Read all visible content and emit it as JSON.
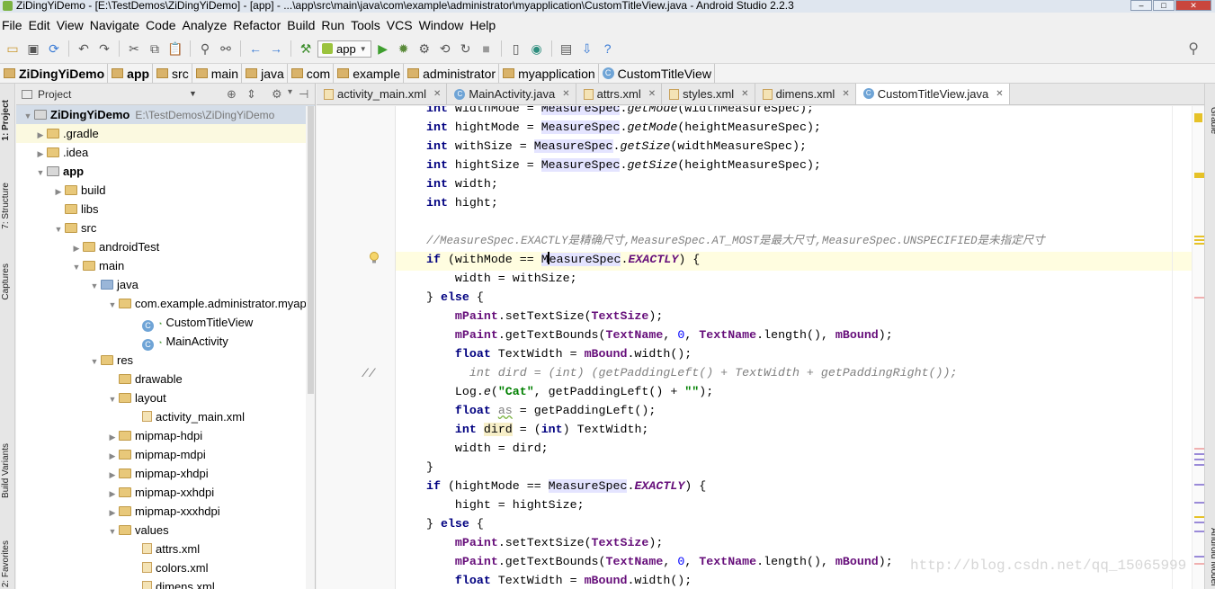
{
  "window": {
    "title": "ZiDingYiDemo - [E:\\TestDemos\\ZiDingYiDemo] - [app] - ...\\app\\src\\main\\java\\com\\example\\administrator\\myapplication\\CustomTitleView.java - Android Studio 2.2.3",
    "min": "–",
    "max": "□",
    "close": "✕"
  },
  "menu": [
    "File",
    "Edit",
    "View",
    "Navigate",
    "Code",
    "Analyze",
    "Refactor",
    "Build",
    "Run",
    "Tools",
    "VCS",
    "Window",
    "Help"
  ],
  "toolbar": {
    "run_config": "app"
  },
  "breadcrumb": [
    "ZiDingYiDemo",
    "app",
    "src",
    "main",
    "java",
    "com",
    "example",
    "administrator",
    "myapplication",
    "CustomTitleView"
  ],
  "side_tabs": {
    "left": [
      "1: Project",
      "7: Structure",
      "Captures",
      "Build Variants",
      "2: Favorites"
    ],
    "right": [
      "Gradle",
      "Android Model"
    ]
  },
  "project_panel": {
    "view_mode": "Project",
    "tree": [
      {
        "label": "ZiDingYiDemo",
        "path": "E:\\TestDemos\\ZiDingYiDemo"
      },
      {
        "label": ".gradle"
      },
      {
        "label": ".idea"
      },
      {
        "label": "app"
      },
      {
        "label": "build"
      },
      {
        "label": "libs"
      },
      {
        "label": "src"
      },
      {
        "label": "androidTest"
      },
      {
        "label": "main"
      },
      {
        "label": "java"
      },
      {
        "label": "com.example.administrator.myap"
      },
      {
        "label": "CustomTitleView"
      },
      {
        "label": "MainActivity"
      },
      {
        "label": "res"
      },
      {
        "label": "drawable"
      },
      {
        "label": "layout"
      },
      {
        "label": "activity_main.xml"
      },
      {
        "label": "mipmap-hdpi"
      },
      {
        "label": "mipmap-mdpi"
      },
      {
        "label": "mipmap-xhdpi"
      },
      {
        "label": "mipmap-xxhdpi"
      },
      {
        "label": "mipmap-xxxhdpi"
      },
      {
        "label": "values"
      },
      {
        "label": "attrs.xml"
      },
      {
        "label": "colors.xml"
      },
      {
        "label": "dimens.xml"
      }
    ]
  },
  "editor_tabs": [
    {
      "label": "activity_main.xml",
      "active": false
    },
    {
      "label": "MainActivity.java",
      "active": false
    },
    {
      "label": "attrs.xml",
      "active": false
    },
    {
      "label": "styles.xml",
      "active": false
    },
    {
      "label": "dimens.xml",
      "active": false
    },
    {
      "label": "CustomTitleView.java",
      "active": true
    }
  ],
  "code": {
    "l1a": "int",
    "l1b": " widthMode = ",
    "l1c": "MeasureSpec",
    "l1d": ".",
    "l1e": "getMode",
    "l1f": "(widthMeasureSpec);",
    "l2a": "int",
    "l2b": " hightMode = ",
    "l2c": "MeasureSpec",
    "l2d": ".",
    "l2e": "getMode",
    "l2f": "(heightMeasureSpec);",
    "l3a": "int",
    "l3b": " withSize = ",
    "l3c": "MeasureSpec",
    "l3d": ".",
    "l3e": "getSize",
    "l3f": "(widthMeasureSpec);",
    "l4a": "int",
    "l4b": " hightSize = ",
    "l4c": "MeasureSpec",
    "l4d": ".",
    "l4e": "getSize",
    "l4f": "(heightMeasureSpec);",
    "l5a": "int",
    "l5b": " width;",
    "l6a": "int",
    "l6b": " hight;",
    "l8": "//MeasureSpec.EXACTLY是精确尺寸,MeasureSpec.AT_MOST是最大尺寸,MeasureSpec.UNSPECIFIED是未指定尺寸",
    "l9a": "if",
    "l9b": " (withMode == ",
    "l9c": "M",
    "l9d": "easureSpec",
    "l9e": ".",
    "l9f": "EXACTLY",
    "l9g": ") {",
    "l10": "    width = withSize;",
    "l11a": "} ",
    "l11b": "else",
    "l11c": " {",
    "l12a": "    ",
    "l12b": "mPaint",
    "l12c": ".setTextSize(",
    "l12d": "TextSize",
    "l12e": ");",
    "l13a": "    ",
    "l13b": "mPaint",
    "l13c": ".getTextBounds(",
    "l13d": "TextName",
    "l13e": ", ",
    "l13f": "0",
    "l13g": ", ",
    "l13h": "TextName",
    "l13i": ".length(), ",
    "l13j": "mBound",
    "l13k": ");",
    "l14a": "    ",
    "l14b": "float",
    "l14c": " TextWidth = ",
    "l14d": "mBound",
    "l14e": ".width();",
    "l15cm": "//",
    "l15": "      int dird = (int) (getPaddingLeft() + TextWidth + getPaddingRight());",
    "l16a": "    Log.",
    "l16b": "e",
    "l16c": "(",
    "l16d": "\"Cat\"",
    "l16e": ", getPaddingLeft() + ",
    "l16f": "\"\"",
    "l16g": ");",
    "l17a": "    ",
    "l17b": "float",
    "l17c": " ",
    "l17d": "as",
    "l17e": " = getPaddingLeft();",
    "l18a": "    ",
    "l18b": "int",
    "l18c": " ",
    "l18d": "dird",
    "l18e": " = (",
    "l18f": "int",
    "l18g": ") TextWidth;",
    "l19": "    width = dird;",
    "l20": "}",
    "l21a": "if",
    "l21b": " (hightMode == ",
    "l21c": "MeasureSpec",
    "l21d": ".",
    "l21e": "EXACTLY",
    "l21f": ") {",
    "l22": "    hight = hightSize;",
    "l23a": "} ",
    "l23b": "else",
    "l23c": " {",
    "l24a": "    ",
    "l24b": "mPaint",
    "l24c": ".setTextSize(",
    "l24d": "TextSize",
    "l24e": ");",
    "l25a": "    ",
    "l25b": "mPaint",
    "l25c": ".getTextBounds(",
    "l25d": "TextName",
    "l25e": ", ",
    "l25f": "0",
    "l25g": ", ",
    "l25h": "TextName",
    "l25i": ".length(), ",
    "l25j": "mBound",
    "l25k": ");",
    "l26a": "    ",
    "l26b": "float",
    "l26c": " TextWidth = ",
    "l26d": "mBound",
    "l26e": ".width();"
  },
  "watermark": "http://blog.csdn.net/qq_15065999"
}
